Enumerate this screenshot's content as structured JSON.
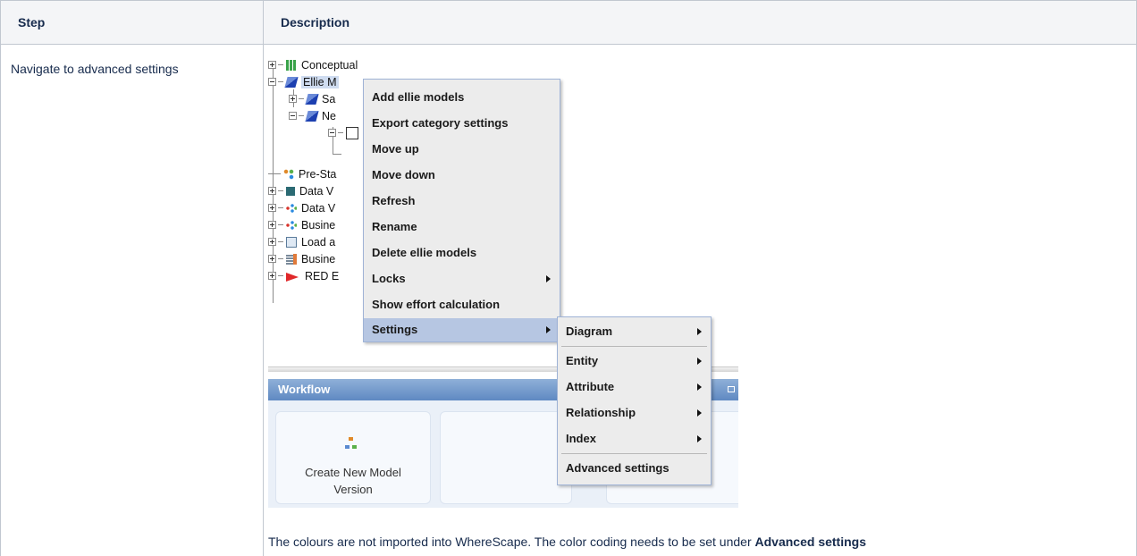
{
  "table": {
    "header_step": "Step",
    "header_description": "Description",
    "step_text": "Navigate to advanced settings",
    "description_text": "The colours are not imported into WhereScape. The color coding needs to be set under ",
    "description_bold": "Advanced settings"
  },
  "tree": {
    "items": [
      {
        "label": "Conceptual",
        "icon": "conceptual-icon"
      },
      {
        "label": "Ellie M",
        "icon": "ellie-models-icon"
      },
      {
        "label": "Sa",
        "icon": "ellie-model-icon"
      },
      {
        "label": "Ne",
        "icon": "ellie-model-icon"
      },
      {
        "label": "",
        "icon": "diagram-icon"
      },
      {
        "label": "Pre-Sta",
        "icon": "pre-stage-icon"
      },
      {
        "label": "Data V",
        "icon": "data-vault-icon"
      },
      {
        "label": "Data V",
        "icon": "data-vault-dots-icon"
      },
      {
        "label": "Busine",
        "icon": "business-icon"
      },
      {
        "label": "Load a",
        "icon": "load-icon"
      },
      {
        "label": "Busine",
        "icon": "business-hub-icon"
      },
      {
        "label": "RED E",
        "icon": "red-icon"
      }
    ]
  },
  "context_menu": {
    "items": [
      {
        "label": "Add ellie models"
      },
      {
        "label": "Export category settings"
      },
      {
        "label": "Move up"
      },
      {
        "label": "Move down"
      },
      {
        "label": "Refresh"
      },
      {
        "label": "Rename"
      },
      {
        "label": "Delete ellie models"
      },
      {
        "label": "Locks",
        "submenu": true
      },
      {
        "label": "Show effort calculation"
      },
      {
        "label": "Settings",
        "submenu": true,
        "active": true
      }
    ]
  },
  "settings_submenu": {
    "items": [
      {
        "label": "Diagram",
        "submenu": true
      },
      {
        "label": "Entity",
        "submenu": true
      },
      {
        "label": "Attribute",
        "submenu": true
      },
      {
        "label": "Relationship",
        "submenu": true
      },
      {
        "label": "Index",
        "submenu": true
      },
      {
        "label": "Advanced settings"
      }
    ]
  },
  "workflow": {
    "title": "Workflow",
    "card1_line1": "Create New Model",
    "card1_line2": "Version"
  },
  "colors": {
    "menu_highlight": "#b6c6e2",
    "panel_header": "#6f95c9",
    "table_header_bg": "#f4f5f7"
  }
}
